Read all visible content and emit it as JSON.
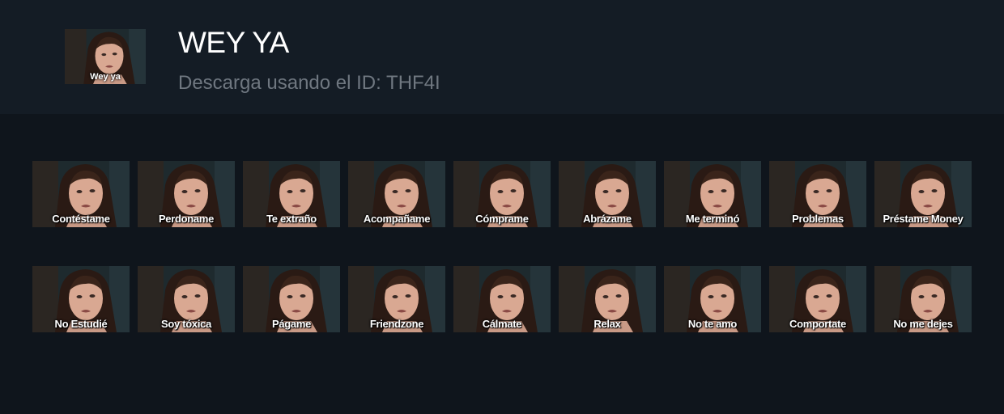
{
  "header": {
    "title": "WEY YA",
    "subtitle": "Descarga usando el ID: THF4I",
    "thumb_label": "Wey ya"
  },
  "tiles": [
    {
      "label": "Contéstame"
    },
    {
      "label": "Perdoname"
    },
    {
      "label": "Te extraño"
    },
    {
      "label": "Acompañame"
    },
    {
      "label": "Cómprame"
    },
    {
      "label": "Abrázame"
    },
    {
      "label": "Me terminó"
    },
    {
      "label": "Problemas"
    },
    {
      "label": "Préstame Money"
    },
    {
      "label": "No Estudié"
    },
    {
      "label": "Soy tóxica"
    },
    {
      "label": "Págame"
    },
    {
      "label": "Friendzone"
    },
    {
      "label": "Cálmate"
    },
    {
      "label": "Relax"
    },
    {
      "label": "No te amo"
    },
    {
      "label": "Comportate"
    },
    {
      "label": "No me dejes"
    }
  ],
  "colors": {
    "page_bg": "#0f151c",
    "header_bg": "#141c25",
    "title": "#ffffff",
    "subtitle": "#6f7780"
  }
}
